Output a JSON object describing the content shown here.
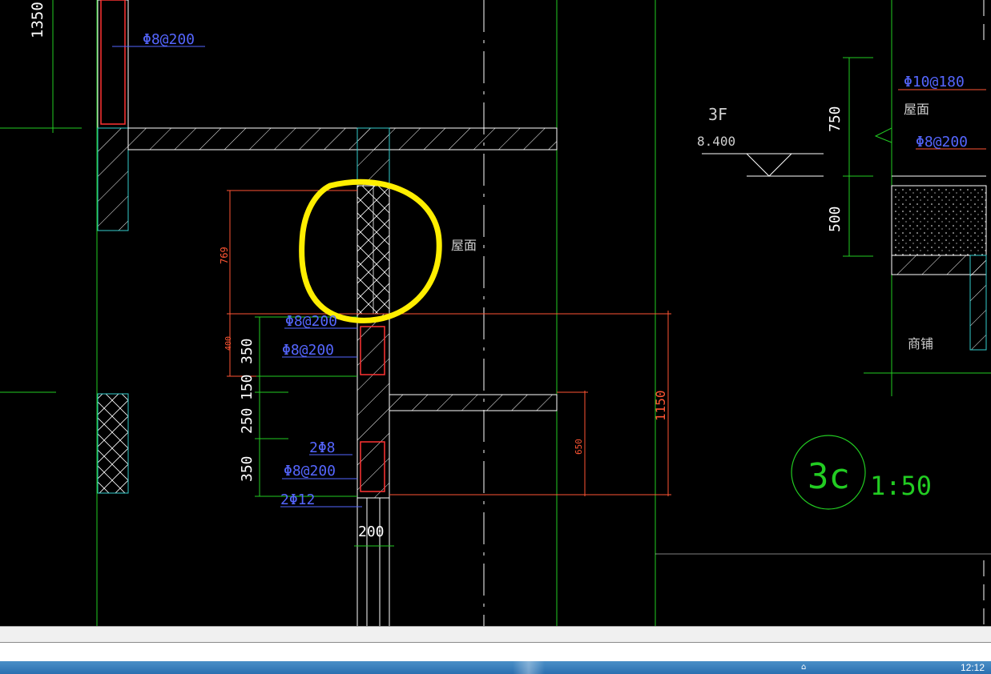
{
  "colors": {
    "background": "#000000",
    "green": "#22cc22",
    "white": "#ffffff",
    "cyan": "#33cccc",
    "red": "#ff3333",
    "orange": "#ff5533",
    "blue": "#5566ff",
    "yellow": "#ffee00",
    "label": "#cfcfcf"
  },
  "labels": {
    "dim_1350": "1350",
    "rebar_top_left": "Φ8@200",
    "level_3f": "3F",
    "level_elev": "8.400",
    "dim_750": "750",
    "dim_500": "500",
    "rebar_right_1": "Φ10@180",
    "roof_right": "屋面",
    "rebar_right_2": "Φ8@200",
    "dim_769": "769",
    "roof_mid": "屋面",
    "shop": "商铺",
    "rebar_mid_1": "Φ8@200",
    "rebar_mid_2": "Φ8@200",
    "dim_400": "400",
    "dim_350_top": "350",
    "dim_150": "150",
    "dim_250": "250",
    "dim_350_bot": "350",
    "rebar_2phi8": "2Φ8",
    "rebar_mid_3": "Φ8@200",
    "rebar_2phi12": "2Φ12",
    "dim_200": "200",
    "dim_650": "650",
    "dim_1150": "1150",
    "detail_id": "3c",
    "detail_scale": "1:50"
  },
  "taskbar": {
    "clock": "12:12",
    "tray": "⌂"
  }
}
